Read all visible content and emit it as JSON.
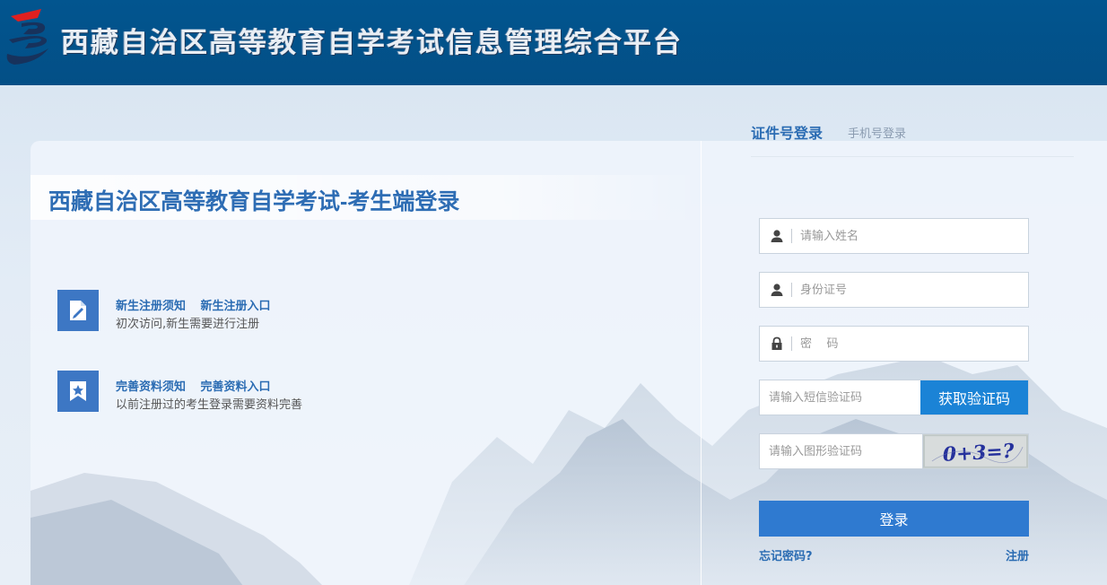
{
  "header": {
    "site_title": "西藏自治区高等教育自学考试信息管理综合平台",
    "logo_icon": "stylized-e-logo"
  },
  "left": {
    "title": "西藏自治区高等教育自学考试-考生端登录",
    "notices": [
      {
        "icon": "edit-document-icon",
        "link1": "新生注册须知",
        "link2": "新生注册入口",
        "desc": "初次访问,新生需要进行注册"
      },
      {
        "icon": "bookmark-star-icon",
        "link1": "完善资料须知",
        "link2": "完善资料入口",
        "desc": "以前注册过的考生登录需要资料完善"
      }
    ]
  },
  "login": {
    "tab_active": "证件号登录",
    "tab_inactive": "手机号登录",
    "name_placeholder": "请输入姓名",
    "id_placeholder": "身份证号",
    "password_placeholder": "密    码",
    "sms_placeholder": "请输入短信验证码",
    "sms_button": "获取验证码",
    "captcha_placeholder": "请输入图形验证码",
    "captcha_text": "0+3=?",
    "login_button": "登录",
    "forgot_link": "忘记密码?",
    "register_link": "注册"
  },
  "colors": {
    "header_bg": "#02558f",
    "accent": "#2f7ad0",
    "sms_button": "#1b83d6",
    "link": "#2b6cb3"
  }
}
